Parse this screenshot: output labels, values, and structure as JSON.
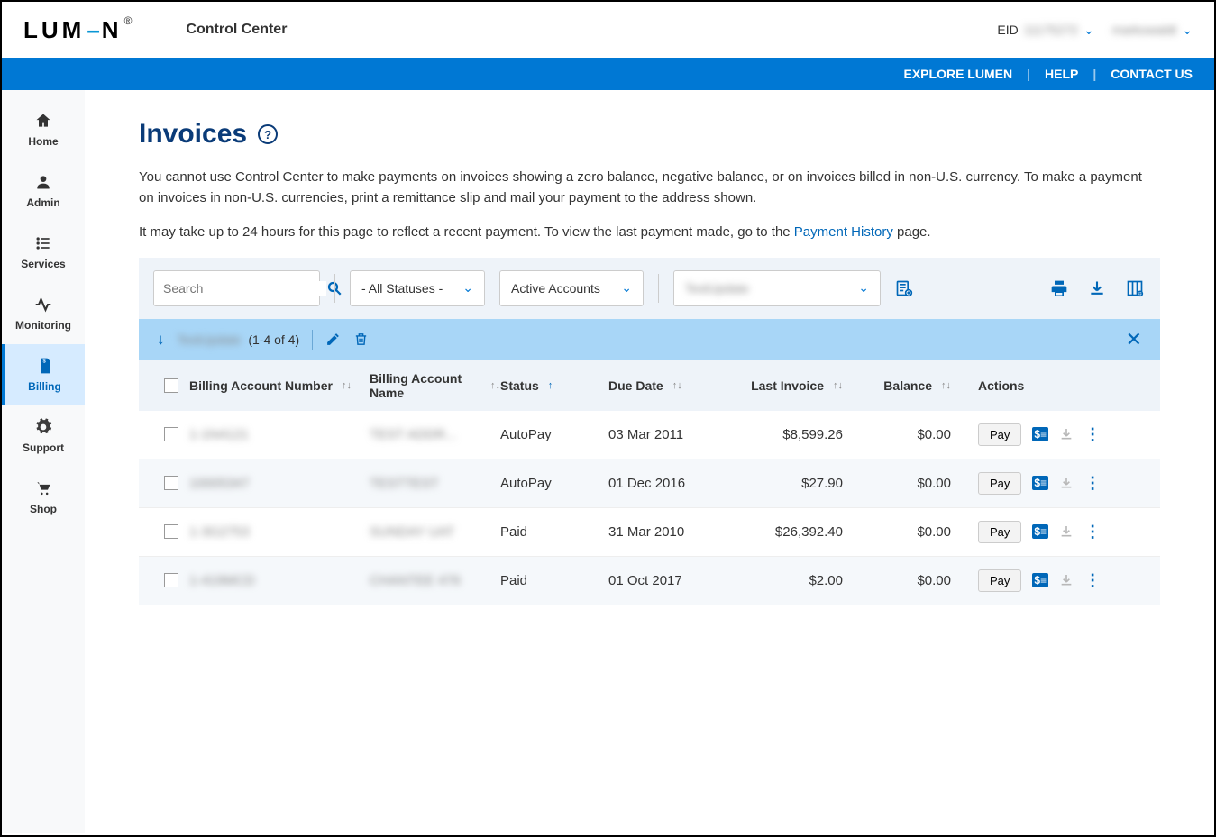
{
  "header": {
    "brand": "LUMEN",
    "app_title": "Control Center",
    "eid_label": "EID",
    "eid_value": "11175272",
    "user_name": "markowaldt"
  },
  "bluebar": {
    "explore": "EXPLORE LUMEN",
    "help": "HELP",
    "contact": "CONTACT US"
  },
  "sidebar": {
    "items": [
      {
        "label": "Home"
      },
      {
        "label": "Admin"
      },
      {
        "label": "Services"
      },
      {
        "label": "Monitoring"
      },
      {
        "label": "Billing"
      },
      {
        "label": "Support"
      },
      {
        "label": "Shop"
      }
    ]
  },
  "page": {
    "title": "Invoices",
    "desc1": "You cannot use Control Center to make payments on invoices showing a zero balance, negative balance, or on invoices billed in non-U.S. currency. To make a payment on invoices in non-U.S. currencies, print a remittance slip and mail your payment to the address shown.",
    "desc2a": "It may take up to 24 hours for this page to reflect a recent payment. To view the last payment made, go to the ",
    "desc2_link": "Payment History",
    "desc2b": " page."
  },
  "filters": {
    "search_placeholder": "Search",
    "status_label": "- All Statuses -",
    "accounts_label": "Active Accounts",
    "third_label": "TestUpdate"
  },
  "selection": {
    "group_name": "TestUpdate",
    "count_text": "(1-4 of 4)"
  },
  "table": {
    "headers": {
      "ban": "Billing Account Number",
      "name": "Billing Account Name",
      "status": "Status",
      "due": "Due Date",
      "last": "Last Invoice",
      "balance": "Balance",
      "actions": "Actions"
    },
    "rows": [
      {
        "ban": "1-1N4121",
        "name": "TEST ADDR...",
        "status": "AutoPay",
        "due": "03 Mar 2011",
        "last": "$8,599.26",
        "balance": "$0.00"
      },
      {
        "ban": "10005347",
        "name": "TESTTEST",
        "status": "AutoPay",
        "due": "01 Dec 2016",
        "last": "$27.90",
        "balance": "$0.00"
      },
      {
        "ban": "1-3G2753",
        "name": "SUNDAY UAT",
        "status": "Paid",
        "due": "31 Mar 2010",
        "last": "$26,392.40",
        "balance": "$0.00"
      },
      {
        "ban": "1-419MCD",
        "name": "CHANTEE 476",
        "status": "Paid",
        "due": "01 Oct 2017",
        "last": "$2.00",
        "balance": "$0.00"
      }
    ],
    "pay_label": "Pay"
  }
}
